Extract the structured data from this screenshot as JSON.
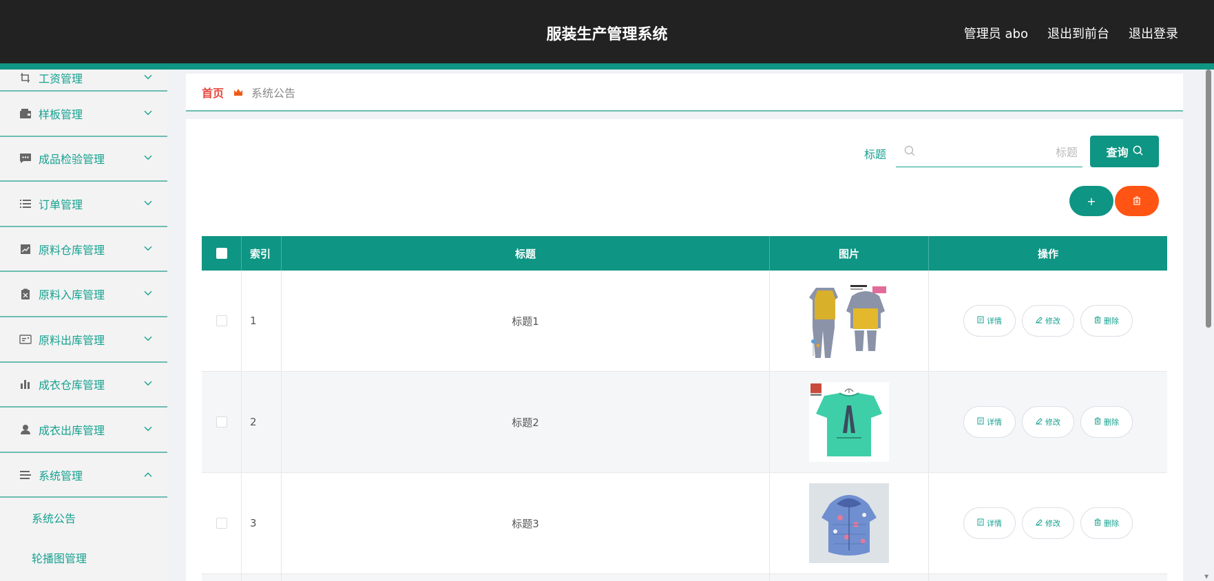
{
  "header": {
    "title": "服装生产管理系统",
    "admin_label": "管理员 abo",
    "front_link": "退出到前台",
    "logout_link": "退出登录"
  },
  "sidebar": {
    "items": [
      {
        "label": "工资管理",
        "icon": "crop-icon"
      },
      {
        "label": "样板管理",
        "icon": "wallet-icon"
      },
      {
        "label": "成品检验管理",
        "icon": "chat-icon"
      },
      {
        "label": "订单管理",
        "icon": "list-icon"
      },
      {
        "label": "原料仓库管理",
        "icon": "trend-chart-icon"
      },
      {
        "label": "原料入库管理",
        "icon": "clipboard-icon"
      },
      {
        "label": "原料出库管理",
        "icon": "card-icon"
      },
      {
        "label": "成衣仓库管理",
        "icon": "bar-chart-icon"
      },
      {
        "label": "成衣出库管理",
        "icon": "user-icon"
      },
      {
        "label": "系统管理",
        "icon": "menu-icon"
      }
    ],
    "submenu": [
      "系统公告",
      "轮播图管理"
    ]
  },
  "breadcrumb": {
    "home": "首页",
    "current": "系统公告"
  },
  "search": {
    "label": "标题",
    "placeholder": "标题",
    "button": "查询"
  },
  "actions": {
    "add": "+"
  },
  "table": {
    "headers": {
      "index": "索引",
      "title": "标题",
      "image": "图片",
      "ops": "操作"
    },
    "rows": [
      {
        "index": "1",
        "title": "标题1",
        "image": "children's yellow and grey hooded jacket set"
      },
      {
        "index": "2",
        "title": "标题2",
        "image": "green t-shirt on hanger"
      },
      {
        "index": "3",
        "title": "标题3",
        "image": "blue floral padded jacket"
      }
    ],
    "op_labels": {
      "detail": "详情",
      "edit": "修改",
      "delete": "删除"
    }
  },
  "colors": {
    "accent": "#0e9583",
    "danger": "#ff5414",
    "topbar": "#222222",
    "home_link": "#e8453b"
  }
}
